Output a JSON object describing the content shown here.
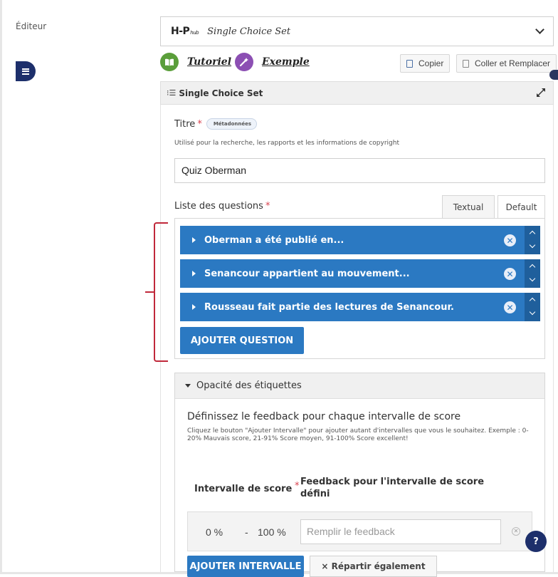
{
  "sidebar": {
    "label": "Éditeur",
    "toggle_icon": "menu-icon"
  },
  "content_type": {
    "logo_main": "H-P",
    "logo_sub": "hub",
    "name": "Single Choice Set"
  },
  "toolbar": {
    "tutorial_label": "Tutoriel",
    "example_label": "Exemple",
    "copy_label": "Copier",
    "paste_label": "Coller et Remplacer",
    "tutorial_color": "#5a9e3a",
    "example_color": "#8c4fb3"
  },
  "section": {
    "title": "Single Choice Set"
  },
  "titre": {
    "label": "Titre",
    "required_mark": "*",
    "metadata_tag": "Métadonnées",
    "help": "Utilisé pour la recherche, les rapports et les informations de copyright",
    "value": "Quiz Oberman"
  },
  "questions": {
    "label": "Liste des questions",
    "required_mark": "*",
    "tabs": [
      "Textual",
      "Default"
    ],
    "active_tab": "Default",
    "items": [
      {
        "title": "Oberman a été publié en..."
      },
      {
        "title": "Senancour appartient au mouvement..."
      },
      {
        "title": "Rousseau fait partie des lectures de Senancour."
      }
    ],
    "add_button": "AJOUTER QUESTION",
    "accent": "#2b79c2",
    "highlight_color": "#c0283a"
  },
  "opacity": {
    "title": "Opacité des étiquettes"
  },
  "feedback": {
    "heading": "Définissez le feedback pour chaque intervalle de score",
    "help": "Cliquez le bouton \"Ajouter Intervalle\" pour ajouter autant d'intervalles que vous le souhaitez. Exemple : 0-20% Mauvais score, 21-91% Score moyen, 91-100% Score excellent!",
    "col_interval": "Intervalle de score",
    "col_required_mark": "*",
    "col_feedback": "Feedback pour l'intervalle de score défini",
    "row": {
      "from": "0 %",
      "dash": "-",
      "to": "100 %",
      "placeholder": "Remplir le feedback"
    },
    "add_button": "AJOUTER INTERVALLE",
    "distribute_button": "× Répartir également"
  },
  "help_fab": {
    "label": "?"
  }
}
